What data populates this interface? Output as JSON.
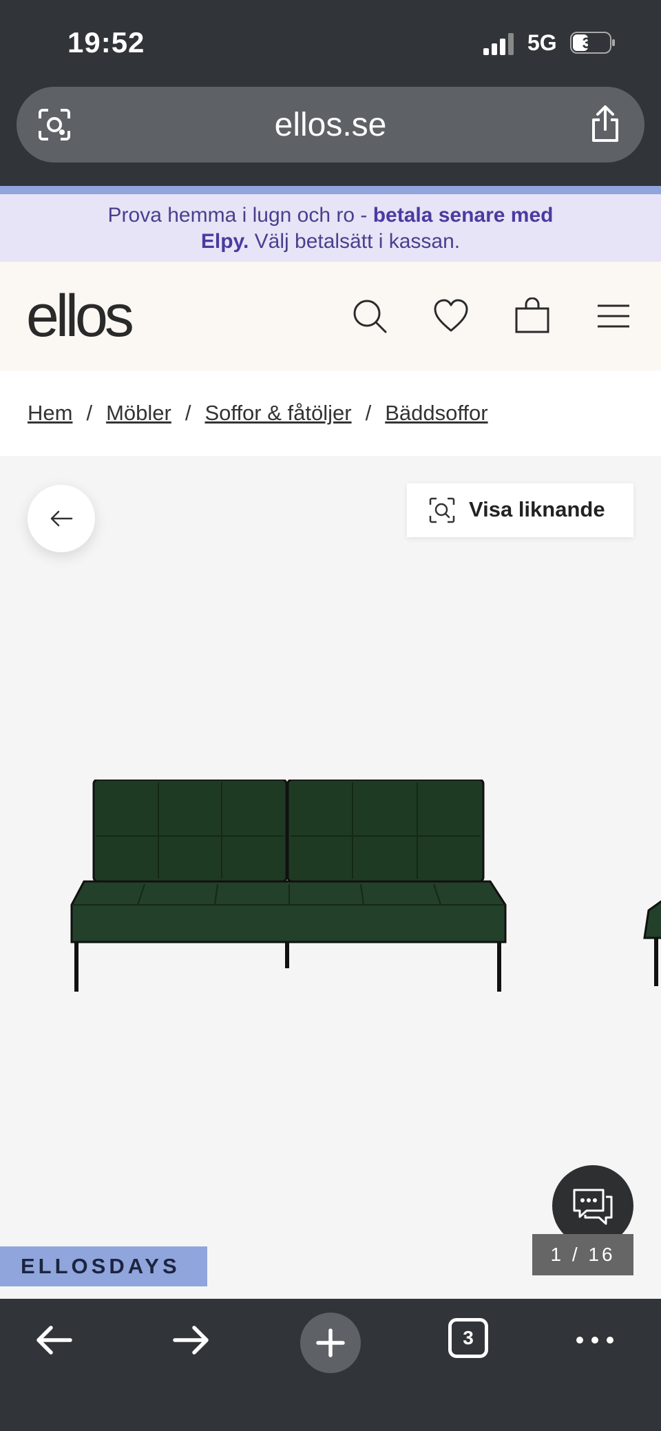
{
  "status": {
    "time": "19:52",
    "network": "5G",
    "battery": "37"
  },
  "browser": {
    "url": "ellos.se",
    "tab_count": "3"
  },
  "promo": {
    "text_before": "Prova hemma i lugn och ro - ",
    "bold_1": "betala senare med",
    "bold_2": "Elpy.",
    "text_after": " Välj betalsätt i kassan."
  },
  "header": {
    "logo": "ellos"
  },
  "breadcrumb": {
    "items": [
      "Hem",
      "Möbler",
      "Soffor & fåtöljer",
      "Bäddsoffor"
    ],
    "separator": "/"
  },
  "gallery": {
    "similar_label": "Visa liknande",
    "pager": "1 / 16",
    "badge": "ELLOSDAYS"
  },
  "colors": {
    "chrome": "#313438",
    "promo_bg": "#e6e4f6",
    "promo_text": "#4b3aa0",
    "badge": "#8fa5dc",
    "sofa": "#1f3a22"
  },
  "icons": [
    "lens-icon",
    "share-icon",
    "search-icon",
    "heart-icon",
    "bag-icon",
    "menu-icon",
    "arrow-left-icon",
    "visual-search-icon",
    "chat-icon",
    "back-icon",
    "forward-icon",
    "plus-icon",
    "more-icon"
  ]
}
